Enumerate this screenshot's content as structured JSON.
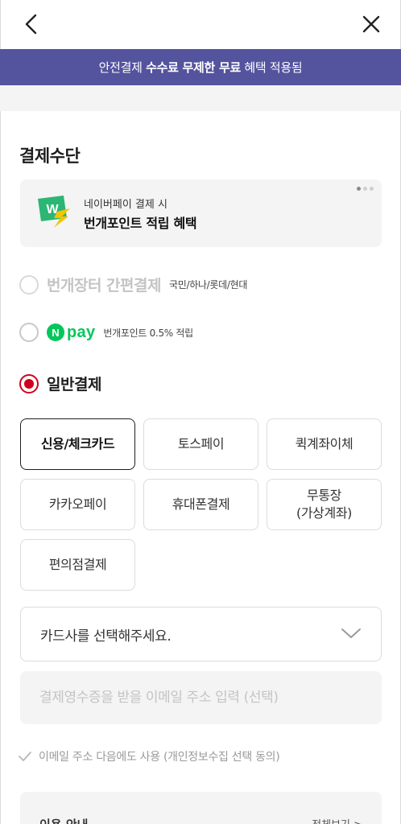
{
  "banner": {
    "prefix": "안전결제",
    "highlight": "수수료 무제한 무료",
    "suffix": "혜택 적용됨"
  },
  "section_title": "결제수단",
  "promo": {
    "subtitle": "네이버페이 결제 시",
    "title": "번개포인트 적립 혜택"
  },
  "payment_options": {
    "bunjang": {
      "label": "번개장터 간편결제",
      "note": "국민/하나/롯데/현대"
    },
    "npay": {
      "logo_n": "N",
      "logo_pay": "pay",
      "note": "번개포인트 0.5% 적립"
    },
    "general": {
      "label": "일반결제"
    }
  },
  "methods": [
    {
      "label": "신용/체크카드"
    },
    {
      "label": "토스페이"
    },
    {
      "label": "퀵계좌이체"
    },
    {
      "label": "카카오페이"
    },
    {
      "label": "휴대폰결제"
    },
    {
      "label": "무통장\n(가상계좌)"
    },
    {
      "label": "편의점결제"
    }
  ],
  "card_select": {
    "placeholder": "카드사를 선택해주세요."
  },
  "email": {
    "placeholder": "결제영수증을 받을 이메일 주소 입력 (선택)"
  },
  "consent": {
    "label": "이메일 주소 다음에도 사용 (개인정보수집 선택 동의)"
  },
  "info": {
    "title": "이용 안내",
    "link": "전체보기 >"
  },
  "colors": {
    "banner": "#54539e",
    "selected_radio": "#d0011b",
    "npay_green": "#03c75a"
  },
  "icons": {
    "back": "chevron-left-icon",
    "close": "close-icon",
    "select": "chevron-down-icon",
    "consent": "check-icon"
  }
}
